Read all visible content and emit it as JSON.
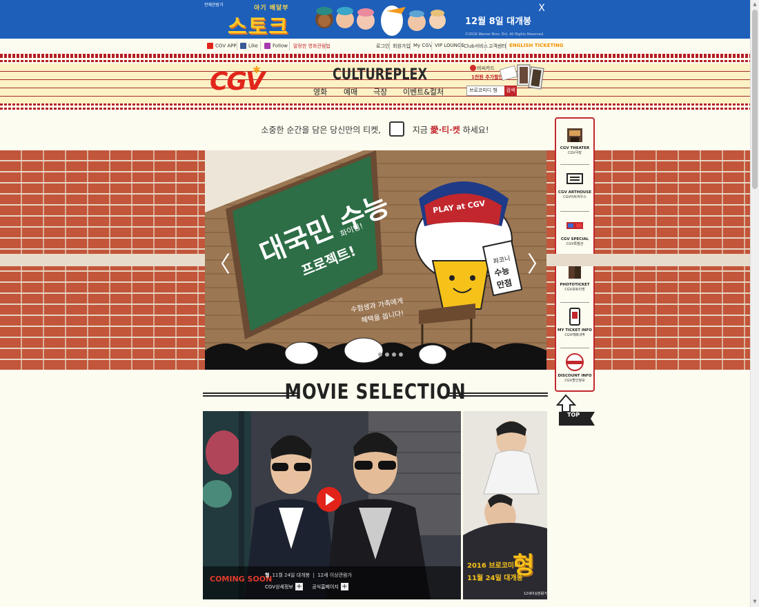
{
  "top_banner": {
    "corner_label": "전체관람가",
    "subtitle": "아기 배달부",
    "title": "스토크",
    "date": "12월 8일 대개봉",
    "copyright": "©2016 Warner Bros. Ent. All Rights Reserved.",
    "close_glyph": "X"
  },
  "util_bar": {
    "cgv_app": "CGV APP",
    "like": "Like",
    "follow": "Follow",
    "guide": "말랑한 영화관람법",
    "login": "로그인",
    "join": "회원가입",
    "my_cgv": "My CGV",
    "vip": "VIP LOUNGE",
    "club": "Club서비스",
    "customer": "고객센터",
    "english": "ENGLISH TICKETING",
    "english_color": "#f29100"
  },
  "header": {
    "logo": "CGV",
    "logo_mark": "✱",
    "culture": "CULTUREPLEX",
    "nav": [
      "영화",
      "예매",
      "극장",
      "이벤트&컬처"
    ],
    "promo_line1": "비씨카드",
    "promo_line2": "1천원 추가할인",
    "search_value": "브로코미디 형",
    "search_btn": "검색",
    "brand_color": "#e2251b"
  },
  "tagline": {
    "text1": "소중한 순간을 담은 당신만의 티켓,",
    "text2": "지금",
    "accent": "愛·티·켓",
    "text3": "하세요!"
  },
  "hero": {
    "board_title": "대국민 수능",
    "board_sub": "프로젝트!",
    "board_small": "화이팅!",
    "cap_text": "PLAY at CGV",
    "sign_line1": "파코니",
    "sign_line2": "수능",
    "sign_line3": "만점",
    "handwriting_line1": "수험생과 가족에게",
    "handwriting_line2": "혜택을 쏩니다!",
    "prev_glyph": "〈",
    "next_glyph": "〉",
    "dots": 4
  },
  "movie_selection": {
    "title": "MOVIE SELECTION",
    "coming_soon": "COMING SOON",
    "movie_name": "형",
    "release_info": "11월 24일 대개봉",
    "rating": "12세 이상관람가",
    "detail_label": "CGV상세정보",
    "official_label": "공식홈페이지",
    "poster_tag": "2016 브로코미디",
    "poster_big": "형",
    "poster_date": "11월 24일 대개봉",
    "poster_rate": "12세이상관람가"
  },
  "quick_menu": [
    {
      "en": "CGV THEATER",
      "ko": "CGV극장"
    },
    {
      "en": "CGV ARTHOUSE",
      "ko": "CGV아트하우스"
    },
    {
      "en": "CGV SPECIAL",
      "ko": "CGV특별관"
    },
    {
      "en": "PHOTOTICKET",
      "ko": "CGV포토티켓"
    },
    {
      "en": "MY TICKET INFO",
      "ko": "CGV예매내역"
    },
    {
      "en": "DISCOUNT INFO",
      "ko": "CGV할인정보"
    }
  ],
  "top_label": "TOP"
}
